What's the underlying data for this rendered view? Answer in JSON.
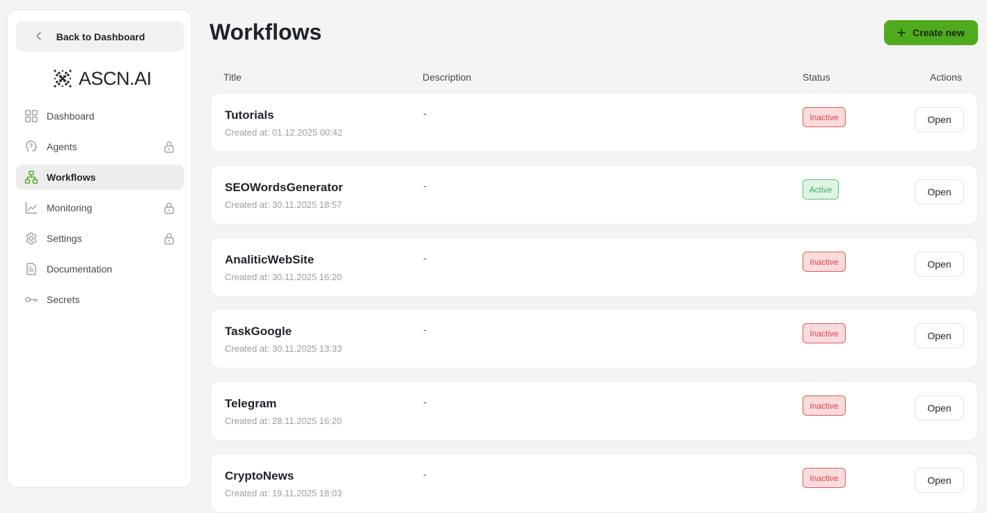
{
  "sidebar": {
    "back_label": "Back to Dashboard",
    "logo_text": "ASCN.AI",
    "items": [
      {
        "label": "Dashboard",
        "icon": "grid-icon",
        "locked": false,
        "active": false
      },
      {
        "label": "Agents",
        "icon": "brain-head-icon",
        "locked": true,
        "active": false
      },
      {
        "label": "Workflows",
        "icon": "workflow-tree-icon",
        "locked": false,
        "active": true
      },
      {
        "label": "Monitoring",
        "icon": "line-chart-icon",
        "locked": true,
        "active": false
      },
      {
        "label": "Settings",
        "icon": "gear-icon",
        "locked": true,
        "active": false
      },
      {
        "label": "Documentation",
        "icon": "document-icon",
        "locked": false,
        "active": false
      },
      {
        "label": "Secrets",
        "icon": "key-icon",
        "locked": false,
        "active": false
      }
    ]
  },
  "header": {
    "title": "Workflows",
    "create_label": "Create new"
  },
  "table": {
    "columns": {
      "title": "Title",
      "description": "Description",
      "status": "Status",
      "actions": "Actions"
    },
    "rows": [
      {
        "title": "Tutorials",
        "created": "Created at: 01.12.2025 00:42",
        "description": "-",
        "status": "Inactive",
        "action": "Open"
      },
      {
        "title": "SEOWordsGenerator",
        "created": "Created at: 30.11.2025 18:57",
        "description": "-",
        "status": "Active",
        "action": "Open"
      },
      {
        "title": "AnaliticWebSite",
        "created": "Created at: 30.11.2025 16:20",
        "description": "-",
        "status": "Inactive",
        "action": "Open"
      },
      {
        "title": "TaskGoogle",
        "created": "Created at: 30.11.2025 13:33",
        "description": "-",
        "status": "Inactive",
        "action": "Open"
      },
      {
        "title": "Telegram",
        "created": "Created at: 28.11.2025 16:20",
        "description": "-",
        "status": "Inactive",
        "action": "Open"
      },
      {
        "title": "CryptoNews",
        "created": "Created at: 19.11.2025 18:03",
        "description": "-",
        "status": "Inactive",
        "action": "Open"
      }
    ]
  },
  "colors": {
    "accent": "#4faa1e",
    "inactive": "#d9434a",
    "active": "#3eaa55"
  }
}
